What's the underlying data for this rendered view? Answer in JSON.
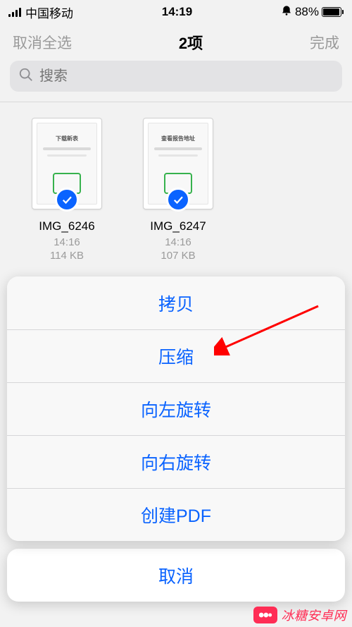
{
  "status": {
    "carrier": "中国移动",
    "time": "14:19",
    "battery_pct": "88%"
  },
  "nav": {
    "left": "取消全选",
    "title": "2项",
    "right": "完成"
  },
  "search": {
    "placeholder": "搜索"
  },
  "files": [
    {
      "name": "IMG_6246",
      "time": "14:16",
      "size": "114 KB"
    },
    {
      "name": "IMG_6247",
      "time": "14:16",
      "size": "107 KB"
    }
  ],
  "sheet": {
    "items": [
      "拷贝",
      "压缩",
      "向左旋转",
      "向右旋转",
      "创建PDF"
    ],
    "cancel": "取消"
  },
  "watermark": "冰糖安卓网",
  "colors": {
    "accent": "#0a63ff",
    "arrow": "#ff0000",
    "wm": "#ff2d55"
  }
}
